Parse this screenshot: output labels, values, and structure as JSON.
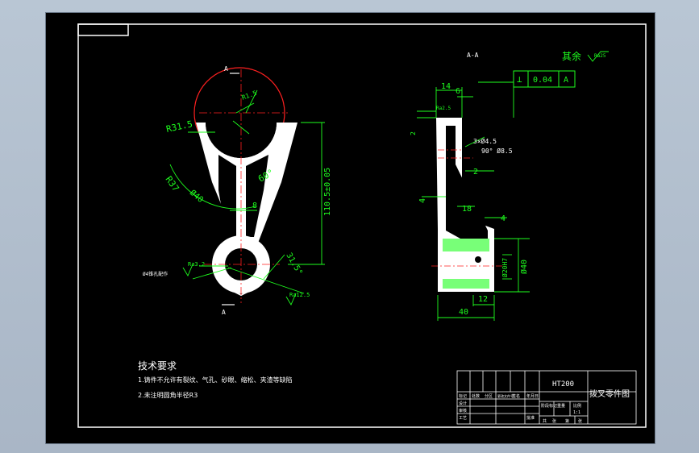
{
  "section_label": "A-A",
  "section_mark": "A",
  "roughness_rest": {
    "text": "其余",
    "value": "Ra25"
  },
  "tolerance_frame": {
    "symbol": "⊥",
    "value": "0.04",
    "datum": "A"
  },
  "front_view": {
    "dims": {
      "r315": "R31.5",
      "r37": "R37",
      "d40": "Ø40",
      "angle60": "60°",
      "w8": "8",
      "h1105": "110.5±0.05",
      "angle315": "31.5°",
      "r_small": "R1.5"
    },
    "callouts": {
      "ra32_label": "Ra3.2",
      "ra32_note": "Ø4锥孔配作",
      "ra125": "Ra12.5"
    }
  },
  "side_view": {
    "dims": {
      "d14": "14",
      "d6": "6",
      "d2top": "2",
      "ra25": "Ra2.5",
      "hole_spec_1": "3×Ø4.5",
      "hole_spec_2": "90° Ø8.5",
      "d2": "2",
      "d4": "4",
      "d18": "18",
      "d4b": "4",
      "d20": "Ø20H7",
      "d40v": "Ø40",
      "d12": "12",
      "d40": "40"
    }
  },
  "tech_req": {
    "title": "技术要求",
    "line1": "1.铸件不允许有裂纹、气孔、砂眼、缩松、夹渣等缺陷",
    "line2": "2.未注明圆角半径R3"
  },
  "title_block": {
    "material": "HT200",
    "part_name": "拨叉零件图",
    "row_labels": [
      "标记",
      "处数",
      "分区",
      "更改文件号",
      "签名",
      "年月日"
    ],
    "stage_labels": [
      "阶段标记",
      "重量",
      "比例"
    ],
    "scale": "1:1",
    "sheet_labels": [
      "共",
      "张",
      "第",
      "张"
    ],
    "left_labels": [
      "设计",
      "审核",
      "工艺",
      "批准"
    ]
  },
  "colors": {
    "background": "#000000",
    "outline": "#ffffff",
    "dimension": "#00ff00",
    "centerline": "#ff0000",
    "text": "#ffffff"
  }
}
